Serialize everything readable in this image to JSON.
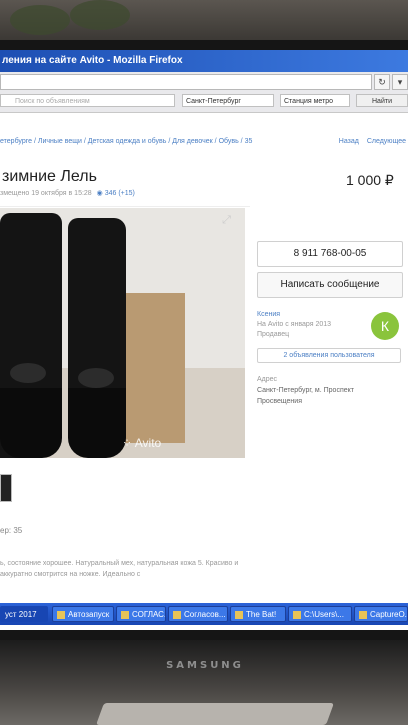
{
  "window": {
    "title": "ления на сайте Avito - Mozilla Firefox"
  },
  "toolbar": {
    "search_placeholder": "Поиск по объявлениям",
    "city": "Санкт-Петербург",
    "metro": "Станция метро",
    "find": "Найти",
    "reload_icon": "reload-icon",
    "menu_icon": "chevron-down-icon"
  },
  "breadcrumb": "етербурге / Личные вещи / Детская одежда и обувь / Для девочек / Обувь / 35",
  "nav": {
    "back": "Назад",
    "next": "Следующее"
  },
  "listing": {
    "title": "зимние Лель",
    "price": "1 000 ₽",
    "posted": "змещено 19 октября в 15:28",
    "views": "346 (+15)",
    "size": "ер: 35",
    "description": "ь, состояние хорошее. Натуральный мех, натуральная кожа 5. Красиво и аккуратно смотрится на ножке. Идеально с",
    "watermark": "Avito"
  },
  "contact": {
    "phone": "8 911 768-00-05",
    "message": "Написать сообщение",
    "seller_name": "Ксения",
    "seller_since": "На Avito с января 2013",
    "seller_role": "Продавец",
    "avatar_letter": "К",
    "ads_count": "2 объявления пользователя",
    "address_label": "Адрес",
    "address_value": "Санкт-Петербург, м. Проспект Просвещения"
  },
  "taskbar": {
    "items": [
      {
        "label": "уст 2017"
      },
      {
        "label": "Автозапуск"
      },
      {
        "label": "СОГЛАС..."
      },
      {
        "label": "Согласов..."
      },
      {
        "label": "The Bat!"
      },
      {
        "label": "C:\\Users\\..."
      },
      {
        "label": "CaptureO..."
      }
    ]
  },
  "monitor": {
    "brand": "SAMSUNG"
  },
  "colors": {
    "link": "#4b7fc4",
    "avatar": "#8ac43c",
    "taskbar": "#2c63d8"
  }
}
